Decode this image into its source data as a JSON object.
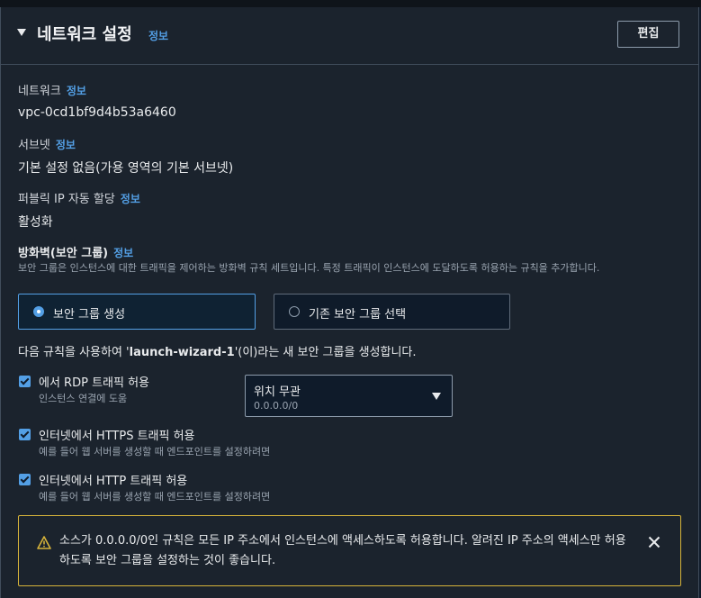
{
  "section": {
    "title": "네트워크 설정",
    "info": "정보",
    "edit_label": "편집"
  },
  "network": {
    "label": "네트워크",
    "info": "정보",
    "value": "vpc-0cd1bf9d4b53a6460"
  },
  "subnet": {
    "label": "서브넷",
    "info": "정보",
    "value": "기본 설정 없음(가용 영역의 기본 서브넷)"
  },
  "public_ip": {
    "label": "퍼블릭 IP 자동 할당",
    "info": "정보",
    "value": "활성화"
  },
  "firewall": {
    "label": "방화벽(보안 그룹)",
    "info": "정보",
    "description": "보안 그룹은 인스턴스에 대한 트래픽을 제어하는 방화벽 규칙 세트입니다. 특정 트래픽이 인스턴스에 도달하도록 허용하는 규칙을 추가합니다.",
    "options": [
      {
        "label": "보안 그룹 생성",
        "selected": true
      },
      {
        "label": "기존 보안 그룹 선택",
        "selected": false
      }
    ],
    "rule_prefix": "다음 규칙을 사용하여 '",
    "rule_name": "launch-wizard-1",
    "rule_suffix": "'(이)라는 새 보안 그룹을 생성합니다."
  },
  "rules": [
    {
      "label": "에서 RDP 트래픽 허용",
      "sub": "인스턴스 연결에 도움",
      "checked": true
    },
    {
      "label": "인터넷에서 HTTPS 트래픽 허용",
      "sub": "예를 들어 웹 서버를 생성할 때 엔드포인트를 설정하려면",
      "checked": true
    },
    {
      "label": "인터넷에서 HTTP 트래픽 허용",
      "sub": "예를 들어 웹 서버를 생성할 때 엔드포인트를 설정하려면",
      "checked": true
    }
  ],
  "source_select": {
    "value": "위치 무관",
    "sub": "0.0.0.0/0"
  },
  "alert": {
    "text": "소스가 0.0.0.0/0인 규칙은 모든 IP 주소에서 인스턴스에 액세스하도록 허용합니다. 알려진 IP 주소의 액세스만 허용하도록 보안 그룹을 설정하는 것이 좋습니다."
  },
  "colors": {
    "accent": "#539fe5",
    "warning": "#d6b33a",
    "panel": "#1b232d",
    "background": "#0f1b2a"
  },
  "icons": [
    "caret-down-icon",
    "warning-icon",
    "close-icon",
    "chevron-down-icon",
    "checkbox-checked-icon",
    "radio-icon"
  ]
}
